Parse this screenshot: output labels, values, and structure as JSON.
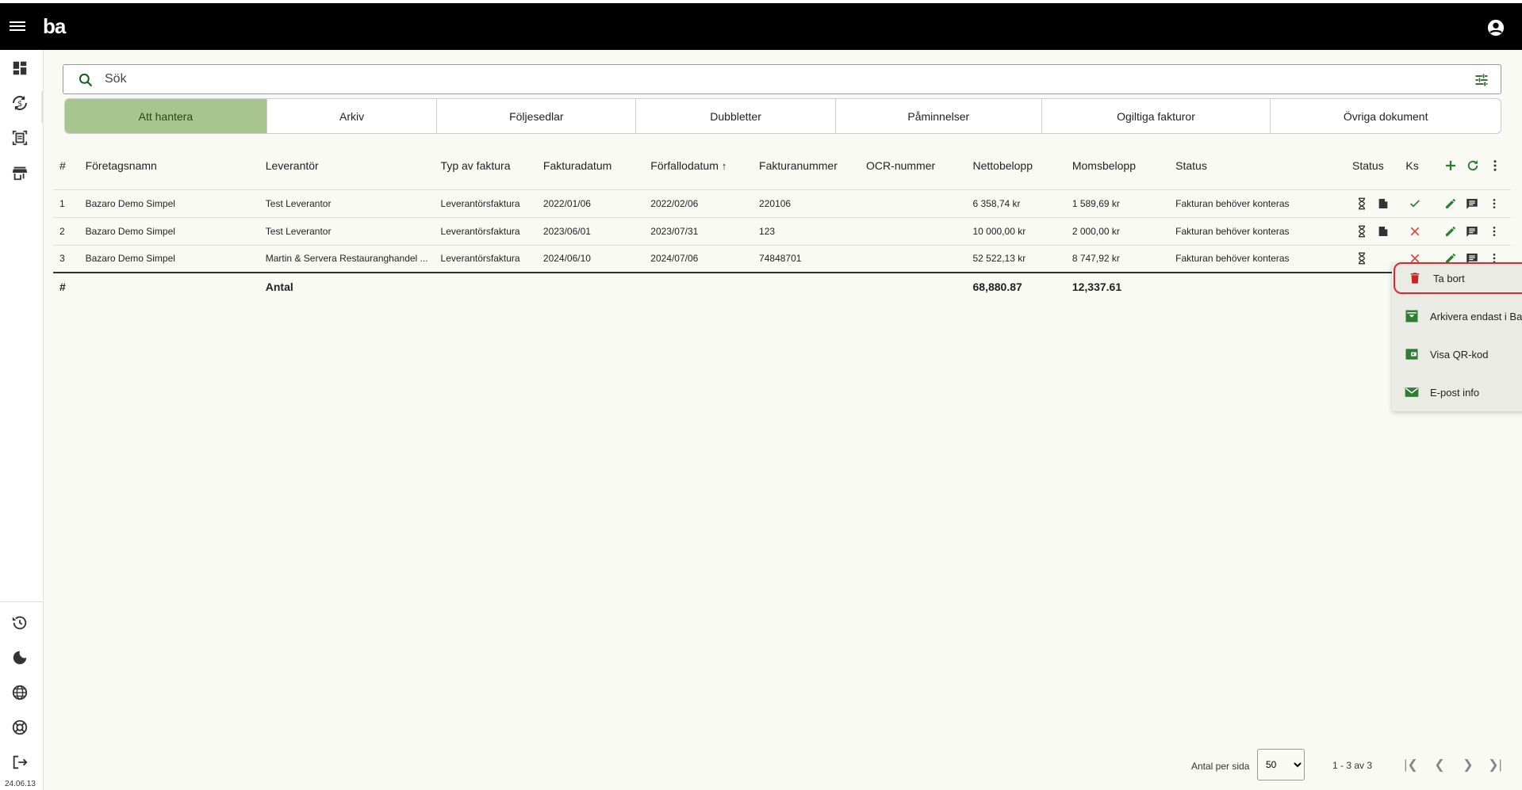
{
  "app": {
    "logo": "ba",
    "version": "24.06.13"
  },
  "search": {
    "placeholder": "Sök"
  },
  "tabs": [
    {
      "label": "Att hantera",
      "active": true
    },
    {
      "label": "Arkiv"
    },
    {
      "label": "Följesedlar"
    },
    {
      "label": "Dubbletter"
    },
    {
      "label": "Påminnelser"
    },
    {
      "label": "Ogiltiga fakturor"
    },
    {
      "label": "Övriga dokument"
    }
  ],
  "table": {
    "headers": {
      "num": "#",
      "company": "Företagsnamn",
      "supplier": "Leverantör",
      "type": "Typ av faktura",
      "invoice_date": "Fakturadatum",
      "due_date": "Förfallodatum",
      "invoice_no": "Fakturanummer",
      "ocr": "OCR-nummer",
      "net": "Nettobelopp",
      "vat": "Momsbelopp",
      "status": "Status",
      "status2": "Status",
      "ks": "Ks"
    },
    "rows": [
      {
        "num": "1",
        "company": "Bazaro Demo Simpel",
        "supplier": "Test Leverantor",
        "type": "Leverantörsfaktura",
        "invoice_date": "2022/01/06",
        "due_date": "2022/02/06",
        "invoice_no": "220106",
        "ocr": "",
        "net": "6 358,74 kr",
        "vat": "1 589,69 kr",
        "status": "Fakturan behöver konteras",
        "ks": "ok"
      },
      {
        "num": "2",
        "company": "Bazaro Demo Simpel",
        "supplier": "Test Leverantor",
        "type": "Leverantörsfaktura",
        "invoice_date": "2023/06/01",
        "due_date": "2023/07/31",
        "invoice_no": "123",
        "ocr": "",
        "net": "10 000,00 kr",
        "vat": "2 000,00 kr",
        "status": "Fakturan behöver konteras",
        "ks": "fail"
      },
      {
        "num": "3",
        "company": "Bazaro Demo Simpel",
        "supplier": "Martin & Servera Restauranghandel ...",
        "type": "Leverantörsfaktura",
        "invoice_date": "2024/06/10",
        "due_date": "2024/07/06",
        "invoice_no": "74848701",
        "ocr": "",
        "net": "52 522,13 kr",
        "vat": "8 747,92 kr",
        "status": "Fakturan behöver konteras",
        "ks": "fail"
      }
    ],
    "totals": {
      "num": "#",
      "label": "Antal",
      "net": "68,880.87",
      "vat": "12,337.61"
    }
  },
  "row_menu": {
    "items": [
      {
        "label": "Ta bort",
        "icon": "trash-icon"
      },
      {
        "label": "Arkivera endast i Bazaro",
        "icon": "archive-icon"
      },
      {
        "label": "Visa QR-kod",
        "icon": "wallet-icon"
      },
      {
        "label": "E-post info",
        "icon": "mail-icon"
      }
    ]
  },
  "pager": {
    "label": "Antal per sida",
    "page_size": "50",
    "range": "1 - 3 av 3"
  },
  "colors": {
    "accent_green": "#2e7d32",
    "tab_active": "#a6c68e",
    "danger": "#e53935",
    "link": "#2979ff"
  }
}
